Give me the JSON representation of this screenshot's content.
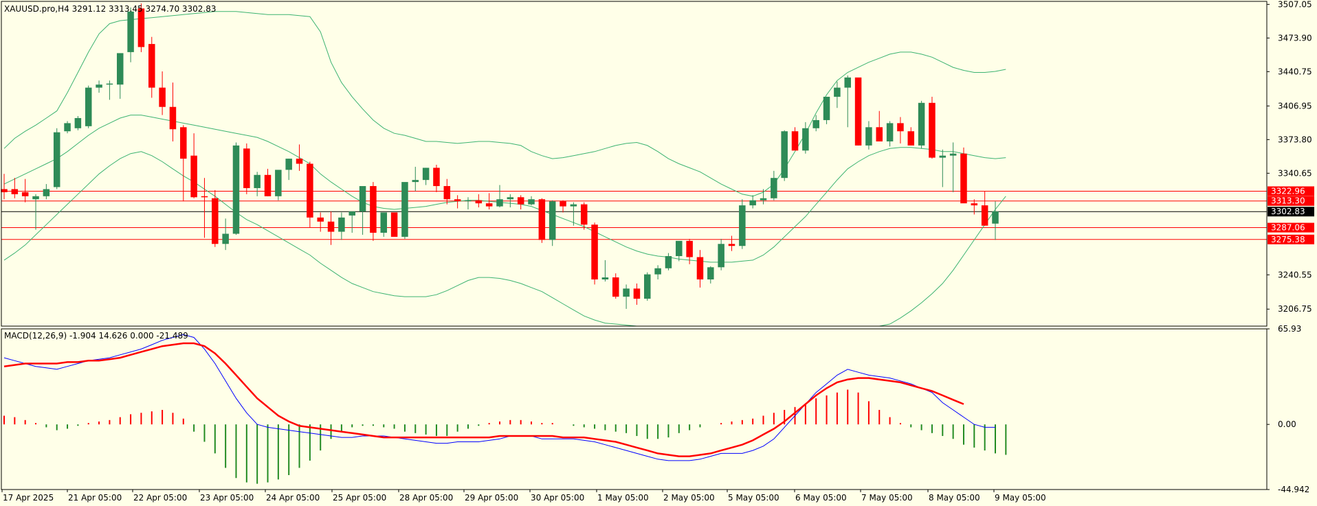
{
  "colors": {
    "background": "#ffffe8",
    "border": "#000000",
    "bull_candle": "#2e8b57",
    "bear_candle": "#ff0000",
    "bands": "#3cb371",
    "macd_line": "#0000ff",
    "signal_line": "#ff0000",
    "hist_pos": "#ff0000",
    "hist_neg": "#228b22",
    "hline": "#ff0000",
    "price_line": "#000000"
  },
  "header": {
    "symbol_info": "XAUUSD.pro,H4  3291.12 3313.45 3274.70 3302.83"
  },
  "macd_header": {
    "text": "MACD(12,26,9) -1.904 14.626 0.000 -21.489"
  },
  "chart_data": [
    {
      "type": "candlestick",
      "symbol": "XAUUSD.pro",
      "timeframe": "H4",
      "ohlc": {
        "open": 3291.12,
        "high": 3313.45,
        "low": 3274.7,
        "close": 3302.83
      },
      "ylim": [
        3190,
        3510
      ],
      "y_ticks": [
        "3507.05",
        "3473.90",
        "3440.75",
        "3406.95",
        "3373.80",
        "3340.65",
        "3240.55",
        "3206.75"
      ],
      "x_ticks": [
        "17 Apr 2025",
        "21 Apr 05:00",
        "22 Apr 05:00",
        "23 Apr 05:00",
        "24 Apr 05:00",
        "25 Apr 05:00",
        "28 Apr 05:00",
        "29 Apr 05:00",
        "30 Apr 05:00",
        "1 May 05:00",
        "2 May 05:00",
        "5 May 05:00",
        "6 May 05:00",
        "7 May 05:00",
        "8 May 05:00",
        "9 May 05:00"
      ],
      "price_tags": [
        {
          "label": "3322.96",
          "value": 3322.96,
          "bg": "#ff0000"
        },
        {
          "label": "3313.30",
          "value": 3313.3,
          "bg": "#ff0000"
        },
        {
          "label": "3302.83",
          "value": 3302.83,
          "bg": "#000000"
        },
        {
          "label": "3287.06",
          "value": 3287.06,
          "bg": "#ff0000"
        },
        {
          "label": "3275.38",
          "value": 3275.38,
          "bg": "#ff0000"
        }
      ],
      "candles": [
        [
          3325,
          3340,
          3315,
          3322
        ],
        [
          3325,
          3336,
          3316,
          3320
        ],
        [
          3322,
          3335,
          3312,
          3318
        ],
        [
          3315,
          3320,
          3285,
          3318
        ],
        [
          3318,
          3330,
          3315,
          3325
        ],
        [
          3327,
          3385,
          3325,
          3381
        ],
        [
          3382,
          3392,
          3380,
          3390
        ],
        [
          3385,
          3397,
          3383,
          3395
        ],
        [
          3387,
          3427,
          3385,
          3425
        ],
        [
          3425,
          3432,
          3420,
          3428
        ],
        [
          3428,
          3432,
          3413,
          3429
        ],
        [
          3428,
          3446,
          3414,
          3459
        ],
        [
          3460,
          3504,
          3450,
          3500
        ],
        [
          3503,
          3508,
          3460,
          3465
        ],
        [
          3468,
          3475,
          3415,
          3425
        ],
        [
          3425,
          3441,
          3398,
          3406
        ],
        [
          3406,
          3430,
          3372,
          3384
        ],
        [
          3386,
          3388,
          3313,
          3355
        ],
        [
          3358,
          3380,
          3316,
          3317
        ],
        [
          3318,
          3336,
          3277,
          3317
        ],
        [
          3316,
          3324,
          3268,
          3271
        ],
        [
          3271,
          3296,
          3265,
          3281
        ],
        [
          3281,
          3371,
          3280,
          3368
        ],
        [
          3365,
          3370,
          3320,
          3326
        ],
        [
          3326,
          3342,
          3318,
          3339
        ],
        [
          3339,
          3345,
          3318,
          3318
        ],
        [
          3318,
          3342,
          3314,
          3344
        ],
        [
          3344,
          3355,
          3334,
          3355
        ],
        [
          3355,
          3369,
          3343,
          3350
        ],
        [
          3350,
          3352,
          3287,
          3297
        ],
        [
          3297,
          3302,
          3283,
          3293
        ],
        [
          3293,
          3303,
          3270,
          3283
        ],
        [
          3283,
          3302,
          3275,
          3297
        ],
        [
          3299,
          3300,
          3282,
          3303
        ],
        [
          3303,
          3318,
          3280,
          3328
        ],
        [
          3328,
          3332,
          3274,
          3282
        ],
        [
          3282,
          3301,
          3278,
          3302
        ],
        [
          3302,
          3301,
          3279,
          3278
        ],
        [
          3278,
          3325,
          3276,
          3332
        ],
        [
          3332,
          3347,
          3323,
          3334
        ],
        [
          3334,
          3346,
          3329,
          3346
        ],
        [
          3346,
          3349,
          3322,
          3328
        ],
        [
          3328,
          3335,
          3310,
          3315
        ],
        [
          3315,
          3319,
          3306,
          3313
        ],
        [
          3313,
          3317,
          3305,
          3314
        ],
        [
          3314,
          3320,
          3307,
          3311
        ],
        [
          3311,
          3321,
          3305,
          3308
        ],
        [
          3308,
          3329,
          3307,
          3315
        ],
        [
          3315,
          3320,
          3307,
          3317
        ],
        [
          3317,
          3319,
          3305,
          3310
        ],
        [
          3310,
          3318,
          3309,
          3315
        ],
        [
          3315,
          3316,
          3272,
          3275
        ],
        [
          3275,
          3314,
          3269,
          3313
        ],
        [
          3313,
          3314,
          3302,
          3308
        ],
        [
          3308,
          3312,
          3289,
          3310
        ],
        [
          3310,
          3312,
          3285,
          3290
        ],
        [
          3290,
          3292,
          3231,
          3236
        ],
        [
          3236,
          3255,
          3234,
          3238
        ],
        [
          3238,
          3242,
          3217,
          3219
        ],
        [
          3219,
          3231,
          3207,
          3227
        ],
        [
          3227,
          3232,
          3211,
          3217
        ],
        [
          3217,
          3243,
          3215,
          3241
        ],
        [
          3241,
          3250,
          3236,
          3247
        ],
        [
          3247,
          3262,
          3245,
          3259
        ],
        [
          3259,
          3270,
          3254,
          3274
        ],
        [
          3274,
          3276,
          3251,
          3258
        ],
        [
          3258,
          3265,
          3228,
          3236
        ],
        [
          3236,
          3249,
          3232,
          3248
        ],
        [
          3248,
          3276,
          3245,
          3271
        ],
        [
          3271,
          3279,
          3264,
          3269
        ],
        [
          3269,
          3315,
          3266,
          3309
        ],
        [
          3309,
          3319,
          3306,
          3314
        ],
        [
          3314,
          3325,
          3310,
          3316
        ],
        [
          3316,
          3343,
          3314,
          3336
        ],
        [
          3336,
          3383,
          3333,
          3382
        ],
        [
          3382,
          3386,
          3364,
          3363
        ],
        [
          3363,
          3391,
          3360,
          3385
        ],
        [
          3385,
          3398,
          3382,
          3393
        ],
        [
          3393,
          3416,
          3389,
          3416
        ],
        [
          3416,
          3431,
          3405,
          3425
        ],
        [
          3425,
          3437,
          3386,
          3435
        ],
        [
          3435,
          3410,
          3368,
          3368
        ],
        [
          3368,
          3392,
          3364,
          3386
        ],
        [
          3386,
          3402,
          3380,
          3372
        ],
        [
          3372,
          3392,
          3367,
          3390
        ],
        [
          3390,
          3396,
          3370,
          3382
        ],
        [
          3382,
          3386,
          3373,
          3368
        ],
        [
          3368,
          3412,
          3365,
          3410
        ],
        [
          3410,
          3416,
          3355,
          3356
        ],
        [
          3356,
          3364,
          3327,
          3358
        ],
        [
          3358,
          3371,
          3322,
          3360
        ],
        [
          3360,
          3366,
          3312,
          3311
        ],
        [
          3311,
          3315,
          3300,
          3309
        ],
        [
          3309,
          3323,
          3289,
          3289
        ],
        [
          3291,
          3313,
          3275,
          3303
        ]
      ],
      "bands_upper": [
        3365,
        3375,
        3382,
        3388,
        3395,
        3402,
        3420,
        3440,
        3460,
        3478,
        3488,
        3491,
        3492,
        3493,
        3494,
        3495,
        3496,
        3497,
        3498,
        3499,
        3500,
        3500,
        3500,
        3499,
        3498,
        3497,
        3497,
        3497,
        3496,
        3495,
        3480,
        3450,
        3430,
        3416,
        3404,
        3393,
        3385,
        3380,
        3378,
        3375,
        3372,
        3372,
        3371,
        3370,
        3371,
        3372,
        3372,
        3371,
        3370,
        3368,
        3362,
        3358,
        3355,
        3356,
        3358,
        3360,
        3362,
        3365,
        3368,
        3370,
        3371,
        3368,
        3362,
        3355,
        3350,
        3346,
        3342,
        3336,
        3330,
        3325,
        3320,
        3318,
        3322,
        3330,
        3345,
        3362,
        3380,
        3400,
        3418,
        3432,
        3440,
        3445,
        3450,
        3454,
        3458,
        3460,
        3460,
        3458,
        3455,
        3450,
        3445,
        3442,
        3440,
        3440,
        3441,
        3443
      ],
      "bands_middle": [
        3330,
        3335,
        3340,
        3345,
        3350,
        3355,
        3362,
        3370,
        3378,
        3385,
        3390,
        3395,
        3398,
        3398,
        3396,
        3394,
        3392,
        3390,
        3388,
        3386,
        3384,
        3382,
        3380,
        3378,
        3376,
        3372,
        3367,
        3362,
        3356,
        3350,
        3340,
        3332,
        3325,
        3318,
        3312,
        3308,
        3306,
        3305,
        3306,
        3307,
        3308,
        3310,
        3312,
        3313,
        3314,
        3314,
        3313,
        3312,
        3311,
        3310,
        3308,
        3304,
        3300,
        3296,
        3292,
        3288,
        3283,
        3278,
        3273,
        3268,
        3264,
        3261,
        3259,
        3258,
        3256,
        3255,
        3254,
        3253,
        3253,
        3253,
        3254,
        3255,
        3260,
        3268,
        3278,
        3288,
        3298,
        3310,
        3322,
        3334,
        3345,
        3352,
        3358,
        3362,
        3365,
        3366,
        3366,
        3365,
        3364,
        3362,
        3362,
        3360,
        3358,
        3356,
        3355,
        3356
      ],
      "bands_lower": [
        3255,
        3262,
        3270,
        3280,
        3290,
        3300,
        3310,
        3320,
        3330,
        3340,
        3348,
        3355,
        3360,
        3362,
        3358,
        3352,
        3345,
        3338,
        3332,
        3325,
        3318,
        3310,
        3302,
        3295,
        3290,
        3284,
        3278,
        3272,
        3266,
        3260,
        3252,
        3245,
        3238,
        3232,
        3228,
        3224,
        3222,
        3220,
        3219,
        3219,
        3219,
        3221,
        3225,
        3230,
        3235,
        3238,
        3238,
        3237,
        3235,
        3232,
        3228,
        3224,
        3218,
        3212,
        3206,
        3200,
        3196,
        3193,
        3192,
        3191,
        3190,
        3190,
        3190,
        3190,
        3190,
        3190,
        3190,
        3190,
        3190,
        3190,
        3190,
        3190,
        3190,
        3190,
        3190,
        3190,
        3190,
        3190,
        3190,
        3190,
        3190,
        3190,
        3190,
        3190,
        3192,
        3198,
        3205,
        3213,
        3222,
        3232,
        3245,
        3260,
        3275,
        3290,
        3305,
        3318
      ]
    },
    {
      "type": "macd",
      "title": "MACD(12,26,9)",
      "values": {
        "macd": -1.904,
        "signal": 14.626,
        "zero": 0.0,
        "hist": -21.489
      },
      "ylim": [
        -44.942,
        65.93
      ],
      "y_ticks": [
        "65.93",
        "0.00",
        "-44.942"
      ],
      "macd_line": [
        46,
        44,
        42,
        40,
        39,
        38,
        40,
        42,
        44,
        45,
        46,
        48,
        50,
        52,
        55,
        58,
        60,
        62,
        60,
        52,
        42,
        30,
        18,
        8,
        0,
        -2,
        -3,
        -4,
        -5,
        -6,
        -7,
        -8,
        -9,
        -9,
        -8,
        -8,
        -8,
        -9,
        -10,
        -11,
        -12,
        -13,
        -13,
        -12,
        -12,
        -12,
        -11,
        -10,
        -8,
        -8,
        -8,
        -10,
        -10,
        -10,
        -10,
        -11,
        -12,
        -14,
        -16,
        -18,
        -20,
        -22,
        -24,
        -25,
        -25,
        -25,
        -24,
        -22,
        -20,
        -20,
        -20,
        -18,
        -15,
        -10,
        -2,
        6,
        14,
        22,
        28,
        34,
        38,
        36,
        34,
        33,
        32,
        30,
        28,
        25,
        22,
        15,
        10,
        5,
        0,
        -2,
        -2
      ],
      "signal_line": [
        40,
        41,
        42,
        42,
        42,
        42,
        43,
        43,
        44,
        44,
        45,
        46,
        48,
        50,
        52,
        54,
        55,
        56,
        56,
        54,
        49,
        42,
        34,
        26,
        18,
        12,
        6,
        2,
        -1,
        -2,
        -3,
        -4,
        -5,
        -6,
        -7,
        -8,
        -9,
        -9,
        -9,
        -9,
        -9,
        -9,
        -9,
        -9,
        -9,
        -9,
        -9,
        -8,
        -8,
        -8,
        -8,
        -8,
        -8,
        -9,
        -9,
        -9,
        -10,
        -11,
        -12,
        -14,
        -16,
        -18,
        -20,
        -21,
        -22,
        -22,
        -21,
        -20,
        -18,
        -16,
        -14,
        -11,
        -7,
        -3,
        2,
        8,
        14,
        20,
        25,
        29,
        31,
        32,
        32,
        31,
        30,
        29,
        27,
        25,
        23,
        20,
        17,
        14
      ],
      "histogram": [
        6,
        5,
        3,
        1,
        -2,
        -4,
        -3,
        -1,
        1,
        2,
        3,
        5,
        7,
        8,
        9,
        10,
        8,
        4,
        -5,
        -12,
        -20,
        -30,
        -37,
        -40,
        -41,
        -40,
        -38,
        -35,
        -30,
        -25,
        -18,
        -10,
        -5,
        -2,
        -1,
        -1,
        -2,
        -3,
        -5,
        -6,
        -7,
        -8,
        -8,
        -5,
        -3,
        -1,
        1,
        2,
        3,
        3,
        2,
        1,
        1,
        0,
        -1,
        -2,
        -3,
        -4,
        -5,
        -6,
        -8,
        -10,
        -10,
        -9,
        -6,
        -4,
        -2,
        0,
        1,
        2,
        3,
        4,
        6,
        8,
        10,
        12,
        14,
        18,
        20,
        22,
        24,
        22,
        16,
        10,
        5,
        1,
        -2,
        -4,
        -6,
        -8,
        -10,
        -14,
        -16,
        -18,
        -20,
        -21
      ]
    }
  ]
}
